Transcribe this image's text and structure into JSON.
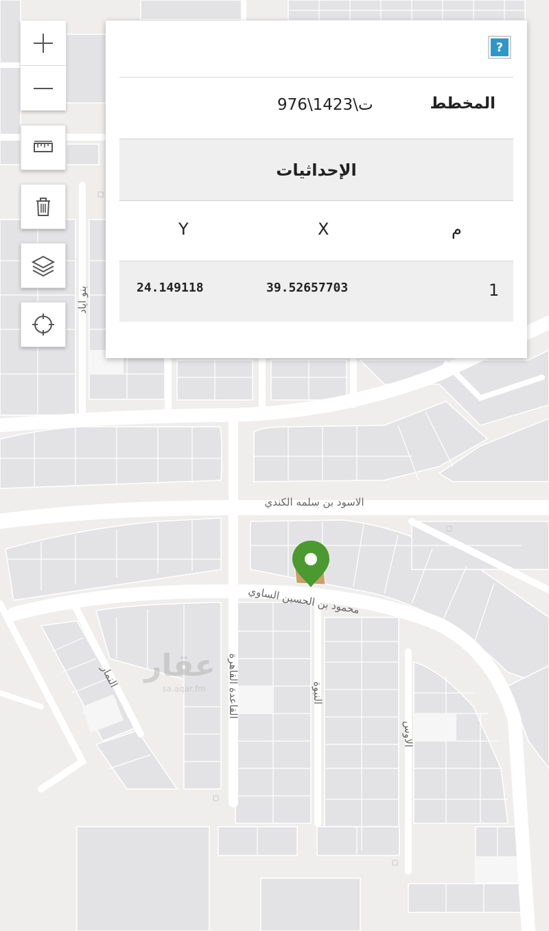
{
  "map": {
    "controls": {
      "zoom_in": "+",
      "zoom_out": "−"
    },
    "streets": [
      {
        "name": "الاسود بن سلمه الكندي"
      },
      {
        "name": "محمود بن الحسين الساوي"
      },
      {
        "name": "بنو اياد"
      },
      {
        "name": "القاعدة القاهرة"
      },
      {
        "name": "النبوة"
      },
      {
        "name": "الاوس"
      },
      {
        "name": "النمار"
      }
    ],
    "watermark": {
      "logo": "عقار",
      "url": "sa.aqar.fm"
    },
    "marker_color": "#4a9a2f"
  },
  "panel": {
    "help_label": "?",
    "plan_label": "المخطط",
    "plan_value": "976\\ت\\1423",
    "coords_title": "الإحداثيات",
    "columns": {
      "index": "م",
      "x": "X",
      "y": "Y"
    },
    "rows": [
      {
        "index": "1",
        "x": "39.52657703",
        "y": "24.149118"
      }
    ]
  }
}
